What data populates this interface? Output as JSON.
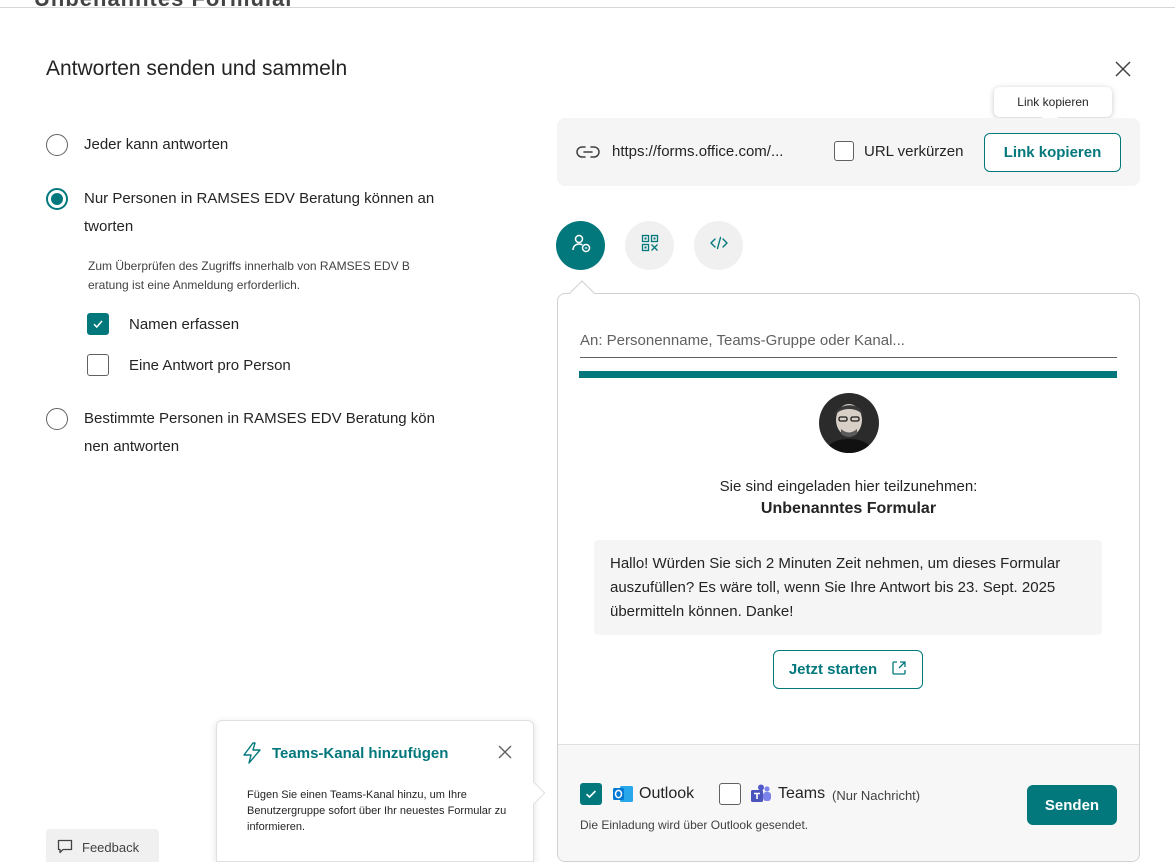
{
  "dialog": {
    "title": "Antworten senden und sammeln",
    "background_title": "Unbenanntes Formular"
  },
  "audience": {
    "options": [
      {
        "label": "Jeder kann antworten",
        "selected": false
      },
      {
        "label": "Nur Personen in RAMSES EDV Beratung können an\ntworten",
        "selected": true
      },
      {
        "label": "Bestimmte Personen in RAMSES EDV Beratung kön\nnen antworten",
        "selected": false
      }
    ],
    "note": "Zum Überprüfen des Zugriffs innerhalb von RAMSES EDV B\neratung ist eine Anmeldung erforderlich.",
    "checkboxes": [
      {
        "label": "Namen erfassen",
        "checked": true
      },
      {
        "label": "Eine Antwort pro Person",
        "checked": false
      }
    ]
  },
  "link": {
    "url": "https://forms.office.com/...",
    "shorten_label": "URL verkürzen",
    "shorten_checked": false,
    "copy_button": "Link kopieren",
    "tooltip": "Link kopieren"
  },
  "share_modes": [
    "person-invite-icon",
    "qr-code-icon",
    "embed-code-icon"
  ],
  "invite": {
    "to_placeholder": "An: Personenname, Teams-Gruppe oder Kanal...",
    "invite_line": "Sie sind eingeladen hier teilzunehmen:",
    "form_name": "Unbenanntes Formular",
    "message": "Hallo! Würden Sie sich 2 Minuten Zeit nehmen, um dieses Formular auszufüllen? Es wäre toll, wenn Sie Ihre Antwort bis 23. Sept. 2025 übermitteln können. Danke!",
    "start_button": "Jetzt starten"
  },
  "footer": {
    "outlook_label": "Outlook",
    "outlook_checked": true,
    "teams_label": "Teams",
    "teams_checked": false,
    "teams_note": "(Nur Nachricht)",
    "hint": "Die Einladung wird über Outlook gesendet.",
    "send_button": "Senden"
  },
  "teams_popup": {
    "title": "Teams-Kanal hinzufügen",
    "body": "Fügen Sie einen Teams-Kanal hinzu, um Ihre Benutzergruppe sofort über Ihr neuestes Formular zu informieren."
  },
  "feedback": {
    "label": "Feedback"
  },
  "colors": {
    "accent": "#03787c",
    "text": "#242424",
    "surface": "#f5f5f5"
  }
}
